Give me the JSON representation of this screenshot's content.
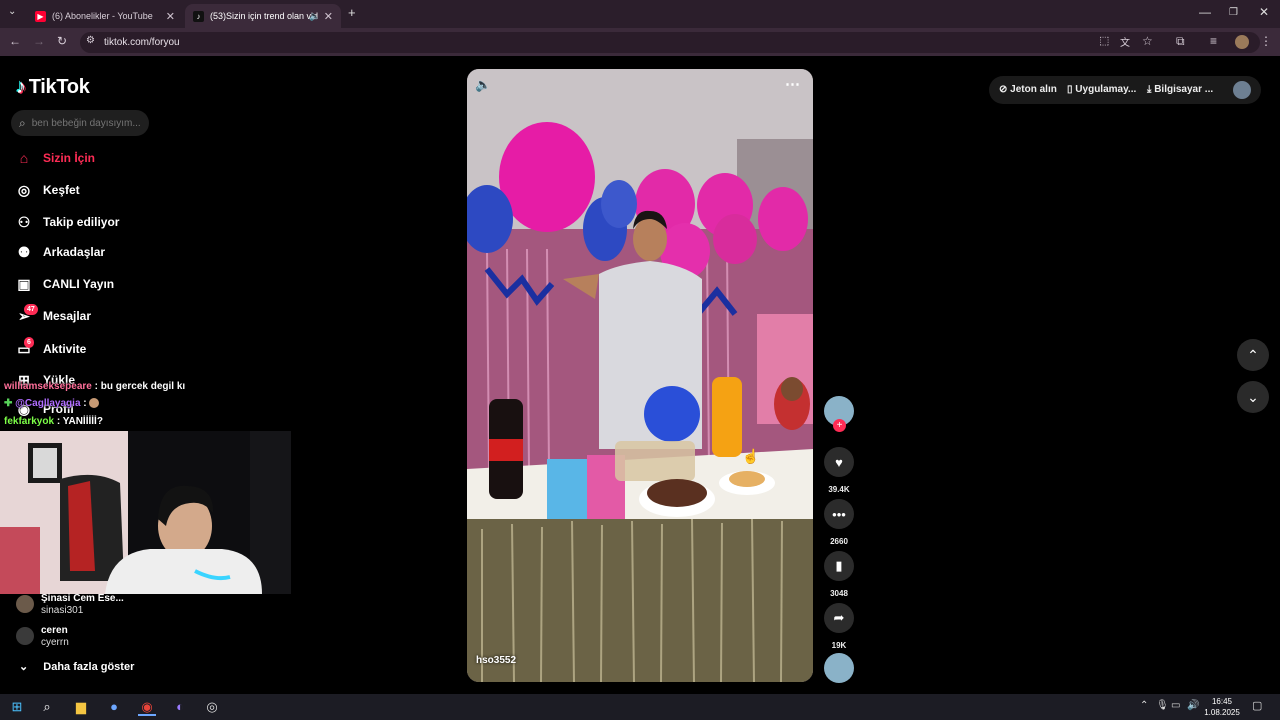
{
  "browser": {
    "tabs": [
      {
        "label": "(6) Abonelikler - YouTube"
      },
      {
        "label": "(53)Sizin için trend olan vid"
      }
    ],
    "url": "tiktok.com/foryou"
  },
  "app": {
    "logo_text": "TikTok",
    "search_placeholder": "ben bebeğin dayısıyım..."
  },
  "sidebar": {
    "items": [
      {
        "label": "Sizin İçin",
        "icon": "home-icon"
      },
      {
        "label": "Keşfet",
        "icon": "compass-icon"
      },
      {
        "label": "Takip ediliyor",
        "icon": "following-icon"
      },
      {
        "label": "Arkadaşlar",
        "icon": "friends-icon"
      },
      {
        "label": "CANLI Yayın",
        "icon": "live-icon"
      },
      {
        "label": "Mesajlar",
        "icon": "messages-icon",
        "badge": "47"
      },
      {
        "label": "Aktivite",
        "icon": "activity-icon",
        "badge": "6"
      },
      {
        "label": "Yükle",
        "icon": "upload-icon"
      },
      {
        "label": "Profil",
        "icon": "profile-icon"
      }
    ],
    "following": [
      {
        "name": "Şinasi  Cem  Ese...",
        "handle": "sinasi301"
      },
      {
        "name": "ceren",
        "handle": "cyerrn"
      }
    ],
    "show_more": "Daha fazla göster"
  },
  "chat": [
    {
      "user": "williamseksepeare",
      "text": ": bu gercek degil kı"
    },
    {
      "user": "@Cagllayagia",
      "text": ":"
    },
    {
      "user": "fekfarkyok",
      "text": ": YANİİİİİ?"
    }
  ],
  "video": {
    "author": "hso3552",
    "likes": "39.4K",
    "comments": "2660",
    "saves": "3048",
    "shares": "19K"
  },
  "topbar": {
    "coins": "Jeton alın",
    "app": "Uygulamay...",
    "desktop": "Bilgisayar ..."
  },
  "taskbar": {
    "time": "16:45",
    "date": "1.08.2025"
  }
}
